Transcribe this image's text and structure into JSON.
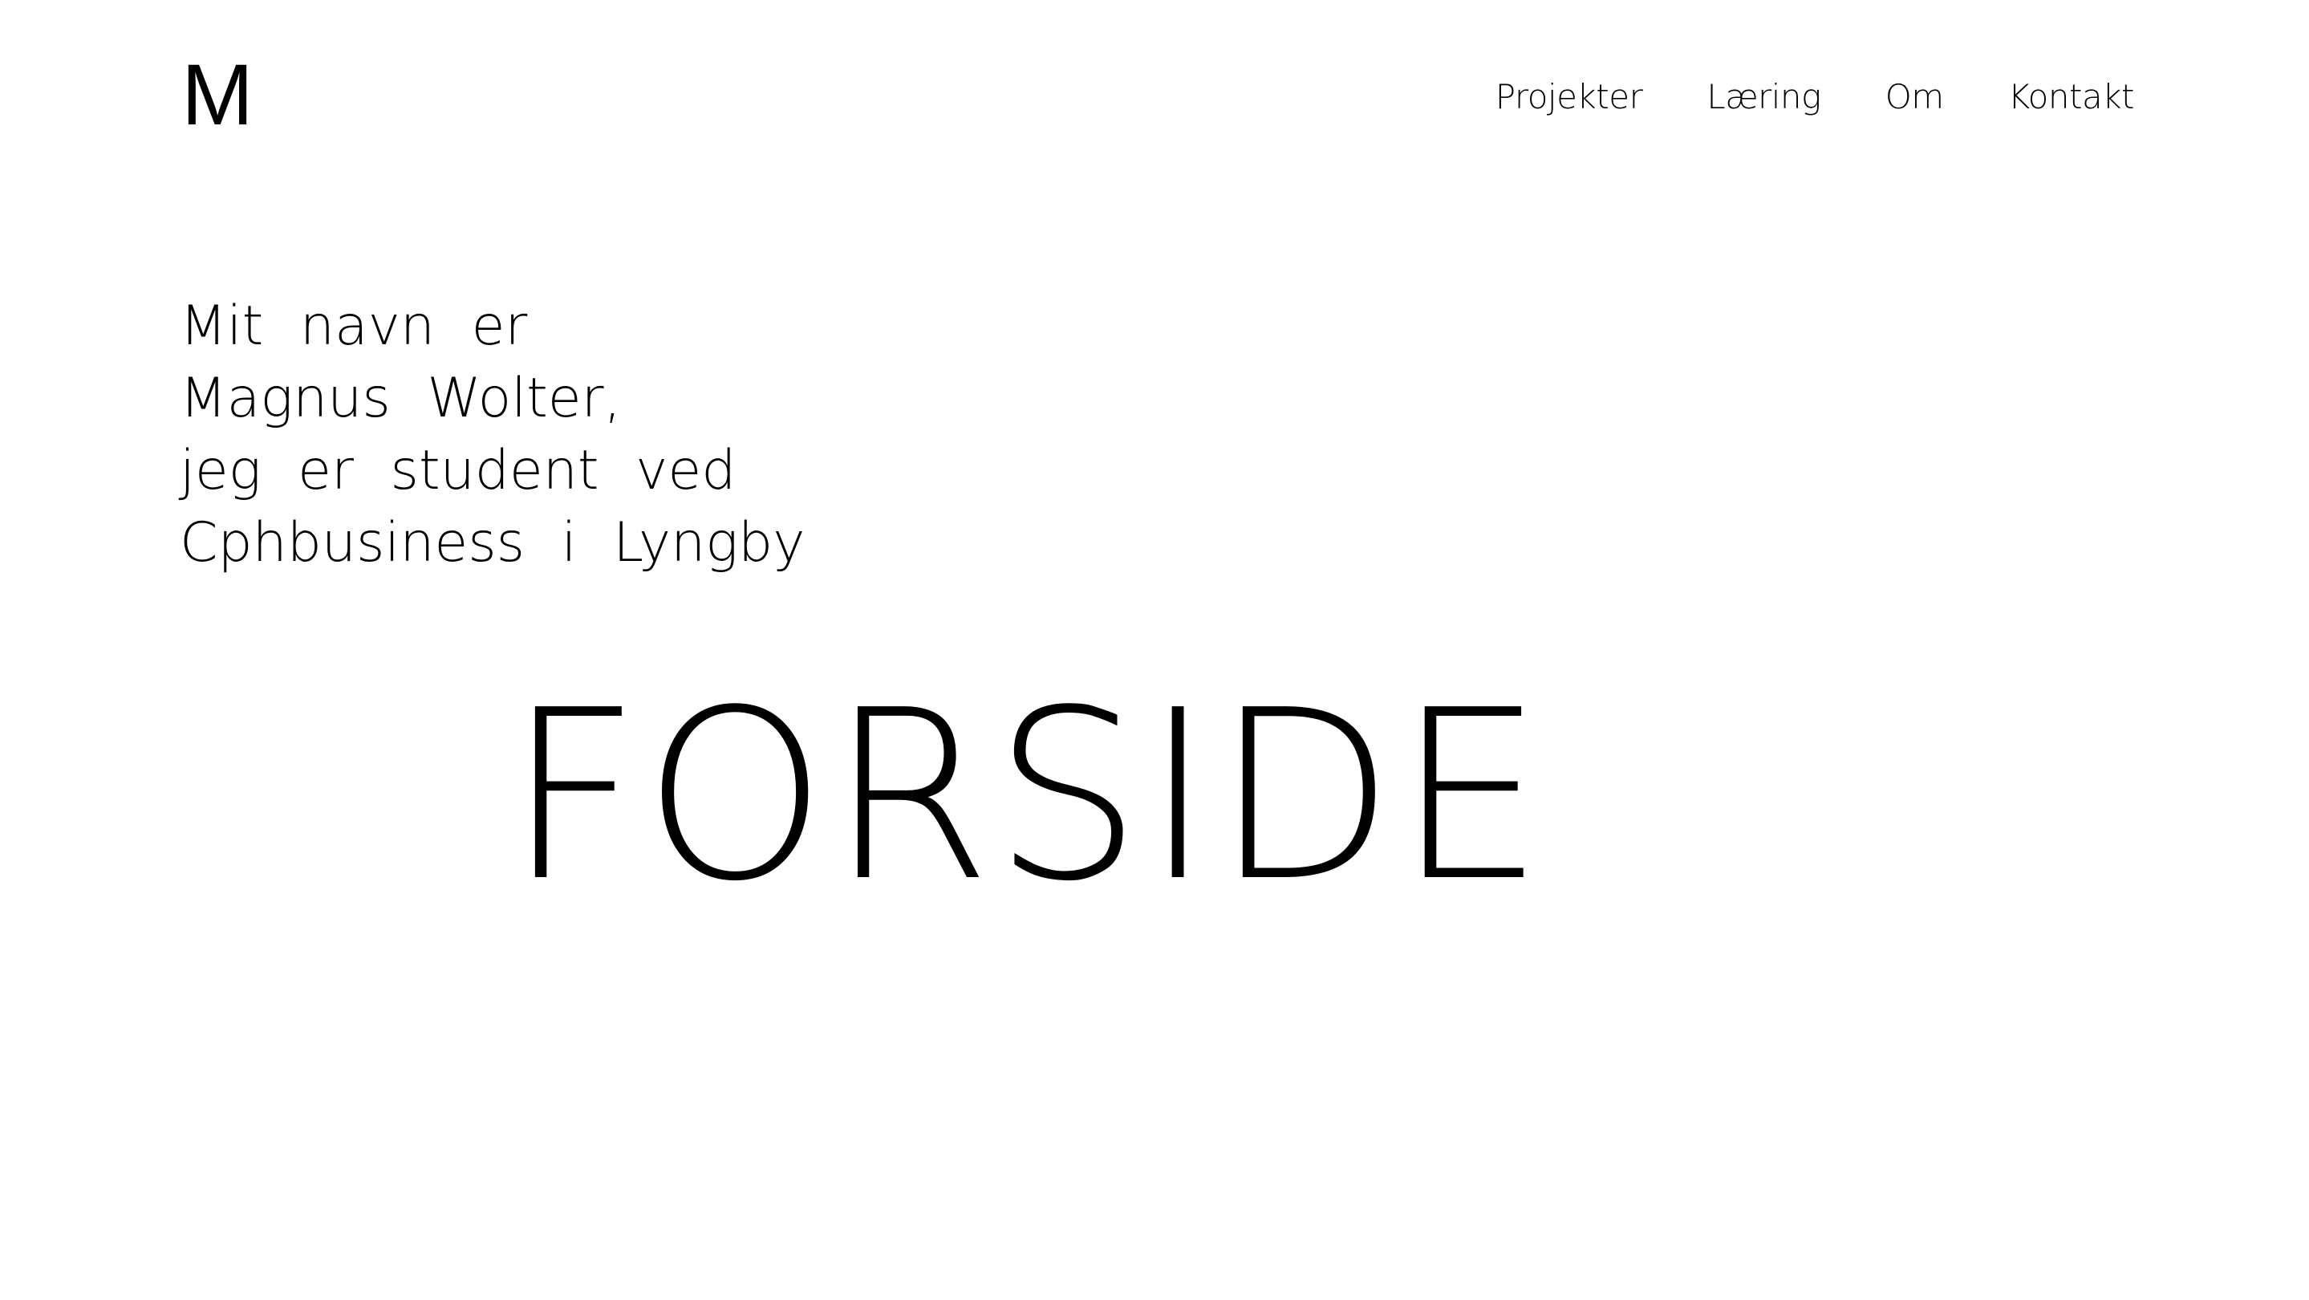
{
  "header": {
    "logo": "M",
    "nav": [
      {
        "label": "Projekter"
      },
      {
        "label": "Læring"
      },
      {
        "label": "Om"
      },
      {
        "label": "Kontakt"
      }
    ]
  },
  "intro": {
    "lines": [
      "Mit navn er",
      "Magnus Wolter,",
      "jeg er student ved",
      "Cphbusiness i Lyngby"
    ]
  },
  "hero": {
    "title": "FORSIDE"
  },
  "colors": {
    "background": "#ffffff",
    "text": "#000000"
  }
}
